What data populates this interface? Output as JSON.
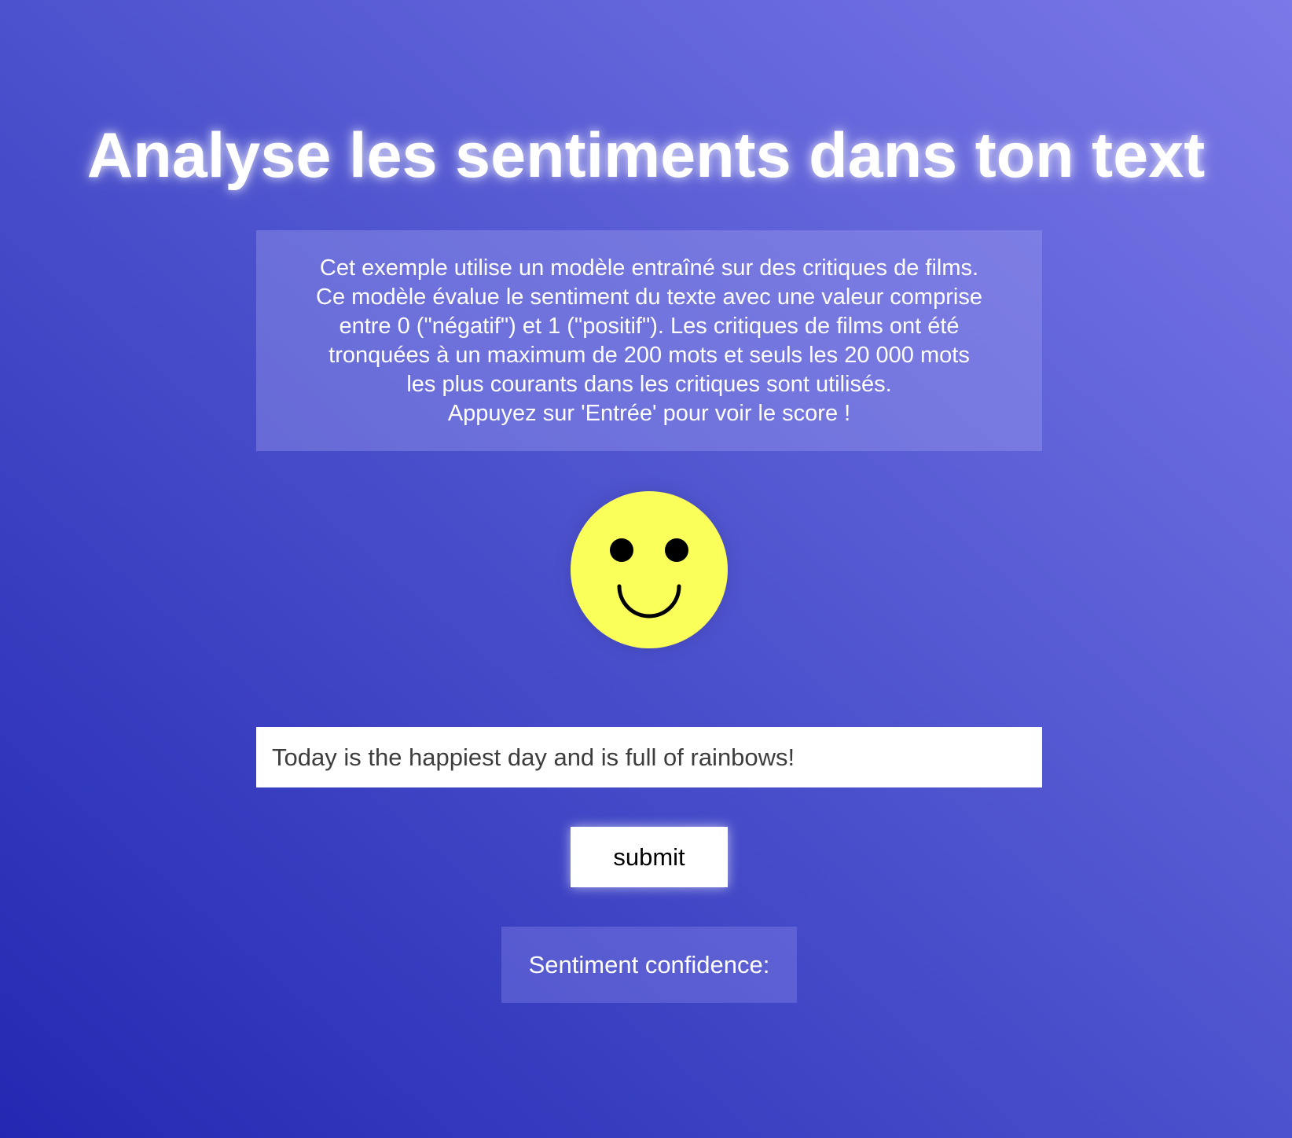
{
  "header": {
    "title": "Analyse les sentiments dans ton text"
  },
  "description": {
    "lines": [
      "Cet exemple utilise un modèle entraîné sur des critiques de films.",
      "Ce modèle évalue le sentiment du texte avec une valeur comprise",
      "entre 0 (\"négatif\") et 1 (\"positif\"). Les critiques de films ont été",
      "tronquées à un maximum de 200 mots et seuls les 20 000 mots",
      "les plus courants dans les critiques sont utilisés.",
      "Appuyez sur 'Entrée' pour voir le score !"
    ]
  },
  "face": {
    "icon": "smiley-face-icon",
    "color": "#fbff5a"
  },
  "input": {
    "value": "Today is the happiest day and is full of rainbows!",
    "placeholder": ""
  },
  "submit": {
    "label": "submit"
  },
  "result": {
    "label": "Sentiment confidence:"
  },
  "colors": {
    "background_start": "#2328b2",
    "background_end": "#7b78e8",
    "face": "#fbff5a"
  }
}
